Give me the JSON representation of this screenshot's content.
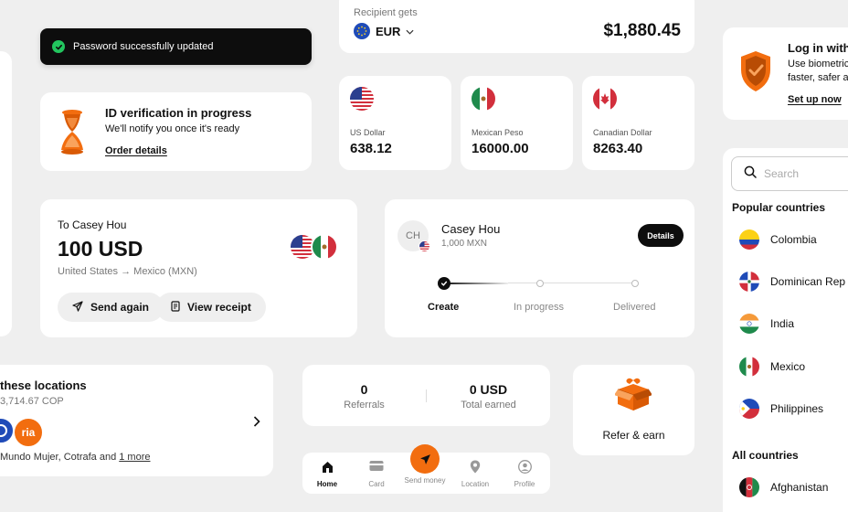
{
  "toast": {
    "message": "Password successfully updated"
  },
  "recipient": {
    "label": "Recipient gets",
    "currency": "EUR",
    "amount": "$1,880.45"
  },
  "id_verification": {
    "title": "ID verification in progress",
    "subtitle": "We'll notify you once it's ready",
    "link": "Order details"
  },
  "currencies": [
    {
      "name": "US Dollar",
      "value": "638.12"
    },
    {
      "name": "Mexican Peso",
      "value": "16000.00"
    },
    {
      "name": "Canadian Dollar",
      "value": "8263.40"
    }
  ],
  "login": {
    "title": "Log in with",
    "line1": "Use biometric",
    "line2": "faster, safer a",
    "link": "Set up now"
  },
  "transfer": {
    "to": "To Casey Hou",
    "amount": "100 USD",
    "route": "United States → Mexico (MXN)",
    "send_again": "Send again",
    "view_receipt": "View receipt"
  },
  "tracker": {
    "initials": "CH",
    "name": "Casey Hou",
    "amount": "1,000 MXN",
    "details": "Details",
    "steps": [
      "Create",
      "In progress",
      "Delivered"
    ]
  },
  "search": {
    "placeholder": "Search"
  },
  "popular": {
    "heading": "Popular countries",
    "items": [
      "Colombia",
      "Dominican Rep",
      "India",
      "Mexico",
      "Philippines"
    ]
  },
  "all": {
    "heading": "All countries",
    "items": [
      "Afghanistan"
    ]
  },
  "locations": {
    "title": "these locations",
    "amount": "3,714.67 COP",
    "text": "Mundo Mujer, Cotrafa and ",
    "more": "1 more",
    "ria": "ria"
  },
  "referrals": {
    "count": "0",
    "count_label": "Referrals",
    "earned": "0 USD",
    "earned_label": "Total earned"
  },
  "refer": {
    "label": "Refer & earn"
  },
  "nav": {
    "home": "Home",
    "card": "Card",
    "send": "Send money",
    "location": "Location",
    "profile": "Profile"
  },
  "colors": {
    "accent": "#f26d0f",
    "success": "#22c55e",
    "dark": "#0d0d0d"
  }
}
